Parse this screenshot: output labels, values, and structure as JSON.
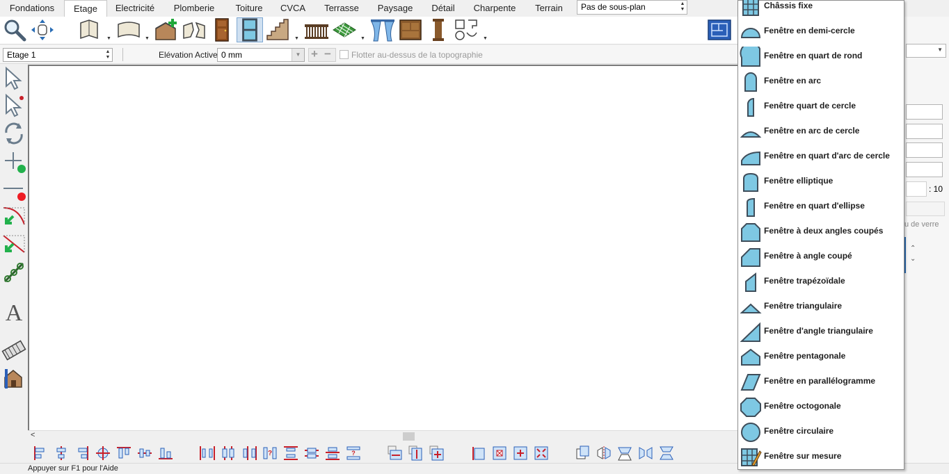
{
  "ribbon": {
    "tabs": [
      {
        "label": "Fondations"
      },
      {
        "label": "Etage",
        "active": true
      },
      {
        "label": "Electricité"
      },
      {
        "label": "Plomberie"
      },
      {
        "label": "Toiture"
      },
      {
        "label": "CVCA"
      },
      {
        "label": "Terrasse"
      },
      {
        "label": "Paysage"
      },
      {
        "label": "Détail"
      },
      {
        "label": "Charpente"
      },
      {
        "label": "Terrain"
      }
    ],
    "subplan_select": {
      "value": "Pas de sous-plan"
    }
  },
  "options_bar": {
    "floor_select": "Etage 1",
    "elevation_label": "Elévation Active:",
    "elevation_value": "0 mm",
    "float_checkbox_label": "Flotter au-dessus de la topographie",
    "float_checked": false
  },
  "right_panel": {
    "ratio_value": ": 10",
    "glass_label": "u de verre"
  },
  "window_menu": {
    "items": [
      {
        "label": "Châssis fixe",
        "icon": "fixed-sash-icon"
      },
      {
        "label": "Fenêtre en demi-cercle",
        "icon": "half-circle-window-icon"
      },
      {
        "label": "Fenêtre en quart de rond",
        "icon": "quarter-round-window-icon"
      },
      {
        "label": "Fenêtre en arc",
        "icon": "arched-window-icon"
      },
      {
        "label": "Fenêtre quart de cercle",
        "icon": "quarter-circle-window-icon"
      },
      {
        "label": "Fenêtre en arc de cercle",
        "icon": "segment-arc-window-icon"
      },
      {
        "label": "Fenêtre en quart d'arc de cercle",
        "icon": "quarter-segment-arc-window-icon"
      },
      {
        "label": "Fenêtre elliptique",
        "icon": "elliptical-window-icon"
      },
      {
        "label": "Fenêtre en quart d'ellipse",
        "icon": "quarter-ellipse-window-icon"
      },
      {
        "label": "Fenêtre à deux angles coupés",
        "icon": "two-clipped-corners-window-icon"
      },
      {
        "label": "Fenêtre à angle coupé",
        "icon": "clipped-corner-window-icon"
      },
      {
        "label": "Fenêtre trapézoïdale",
        "icon": "trapezoid-window-icon"
      },
      {
        "label": "Fenêtre triangulaire",
        "icon": "triangle-window-icon"
      },
      {
        "label": "Fenêtre d'angle triangulaire",
        "icon": "right-triangle-window-icon"
      },
      {
        "label": "Fenêtre pentagonale",
        "icon": "pentagon-window-icon"
      },
      {
        "label": "Fenêtre en parallélogramme",
        "icon": "parallelogram-window-icon"
      },
      {
        "label": "Fenêtre octogonale",
        "icon": "octagon-window-icon"
      },
      {
        "label": "Fenêtre circulaire",
        "icon": "circle-window-icon"
      },
      {
        "label": "Fenêtre sur mesure",
        "icon": "custom-window-icon"
      }
    ]
  },
  "status_bar": {
    "text": "Appuyer sur F1 pour l'Aide"
  },
  "colors": {
    "window_fill": "#7ec8e3",
    "window_stroke": "#3e4d5a",
    "accent": "#2a6db5"
  }
}
